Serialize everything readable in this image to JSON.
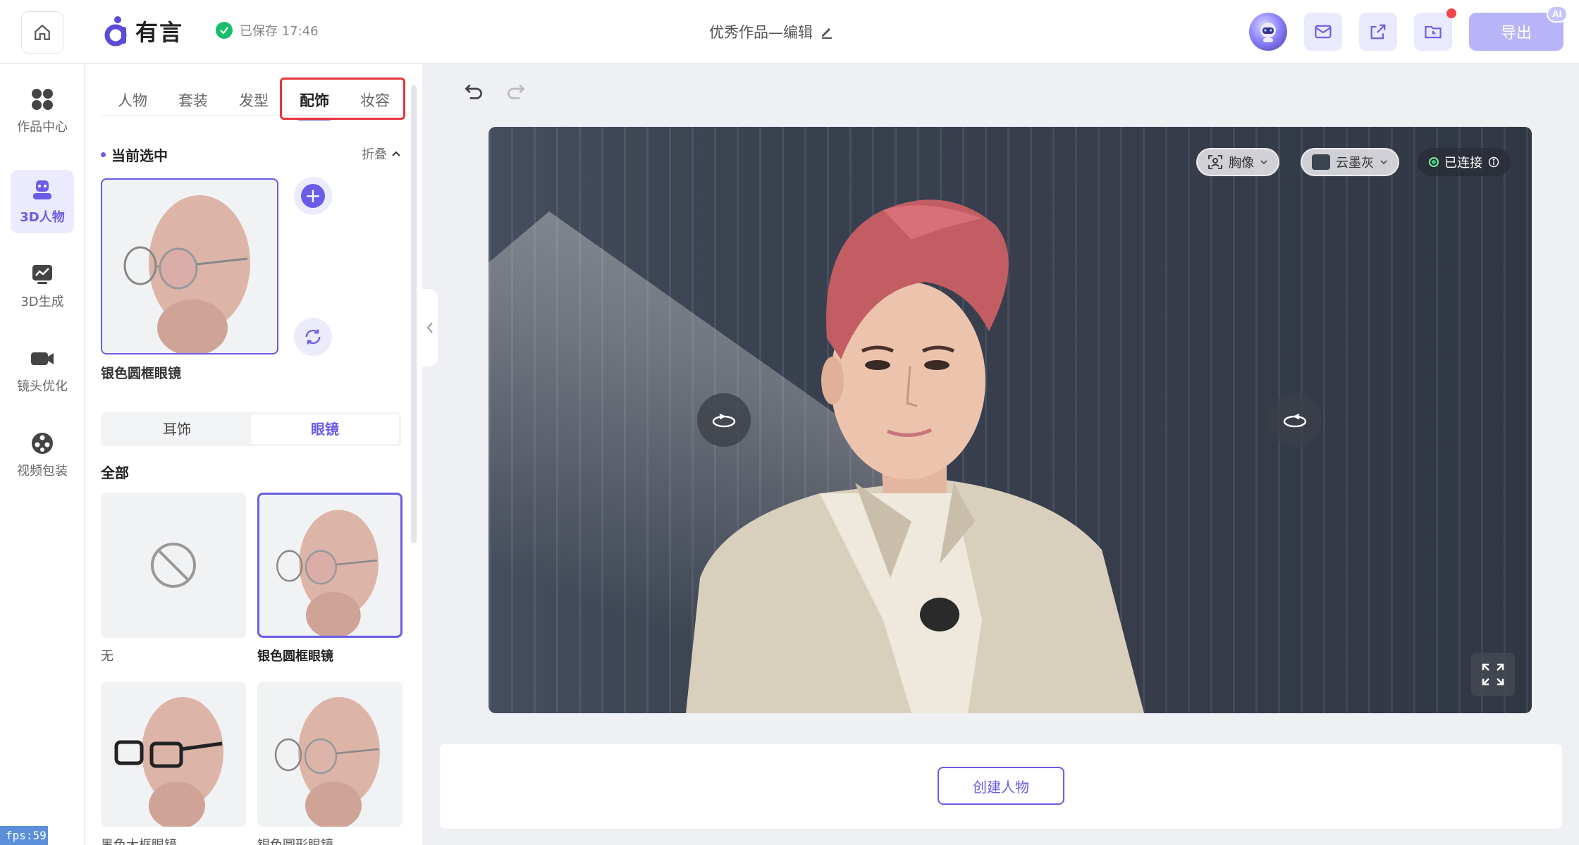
{
  "header": {
    "brand_name": "有言",
    "save_status": "已保存 17:46",
    "doc_title": "优秀作品—编辑",
    "export_label": "导出",
    "ai_badge": "AI"
  },
  "nav": {
    "items": [
      {
        "label": "作品中心",
        "icon": "grid-icon"
      },
      {
        "label": "3D人物",
        "icon": "robot-icon",
        "active": true
      },
      {
        "label": "3D生成",
        "icon": "chart-icon"
      },
      {
        "label": "镜头优化",
        "icon": "camera-icon"
      },
      {
        "label": "视频包装",
        "icon": "film-reel-icon"
      }
    ]
  },
  "panel": {
    "tabs": [
      "人物",
      "套装",
      "发型",
      "配饰",
      "妆容"
    ],
    "active_tab": "配饰",
    "current_title": "当前选中",
    "fold_label": "折叠",
    "current_item": "银色圆框眼镜",
    "subtabs": [
      "耳饰",
      "眼镜"
    ],
    "active_subtab": "眼镜",
    "all_title": "全部",
    "items": [
      {
        "label": "无"
      },
      {
        "label": "银色圆框眼镜",
        "selected": true
      },
      {
        "label": "黑色大框眼镜"
      },
      {
        "label": "银色圆形眼镜"
      }
    ]
  },
  "stage": {
    "view_label": "胸像",
    "background_label": "云墨灰",
    "connection_label": "已连接"
  },
  "footer": {
    "create_label": "创建人物",
    "fps": "fps:59"
  },
  "colors": {
    "accent": "#6a5ce8",
    "highlight": "#e8343d",
    "success": "#19be6b"
  }
}
